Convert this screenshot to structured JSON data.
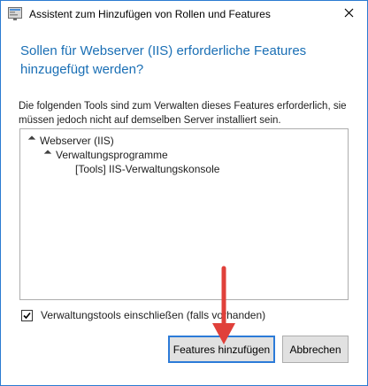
{
  "window": {
    "title": "Assistent zum Hinzufügen von Rollen und Features",
    "close_symbol": "✕",
    "app_icon": "server-manager-icon"
  },
  "dialog": {
    "heading": "Sollen für Webserver (IIS) erforderliche Features hinzugefügt werden?",
    "description": "Die folgenden Tools sind zum Verwalten dieses Features erforderlich, sie müssen jedoch nicht auf demselben Server installiert sein."
  },
  "tree": {
    "items": [
      {
        "label": "Webserver (IIS)"
      },
      {
        "label": "Verwaltungsprogramme"
      },
      {
        "label": "[Tools] IIS-Verwaltungskonsole"
      }
    ]
  },
  "checkbox": {
    "label": "Verwaltungstools einschließen (falls vorhanden)",
    "checked": true
  },
  "buttons": {
    "add_features": "Features hinzufügen",
    "cancel": "Abbrechen"
  },
  "annotation": {
    "arrow_color": "#e0403a"
  }
}
